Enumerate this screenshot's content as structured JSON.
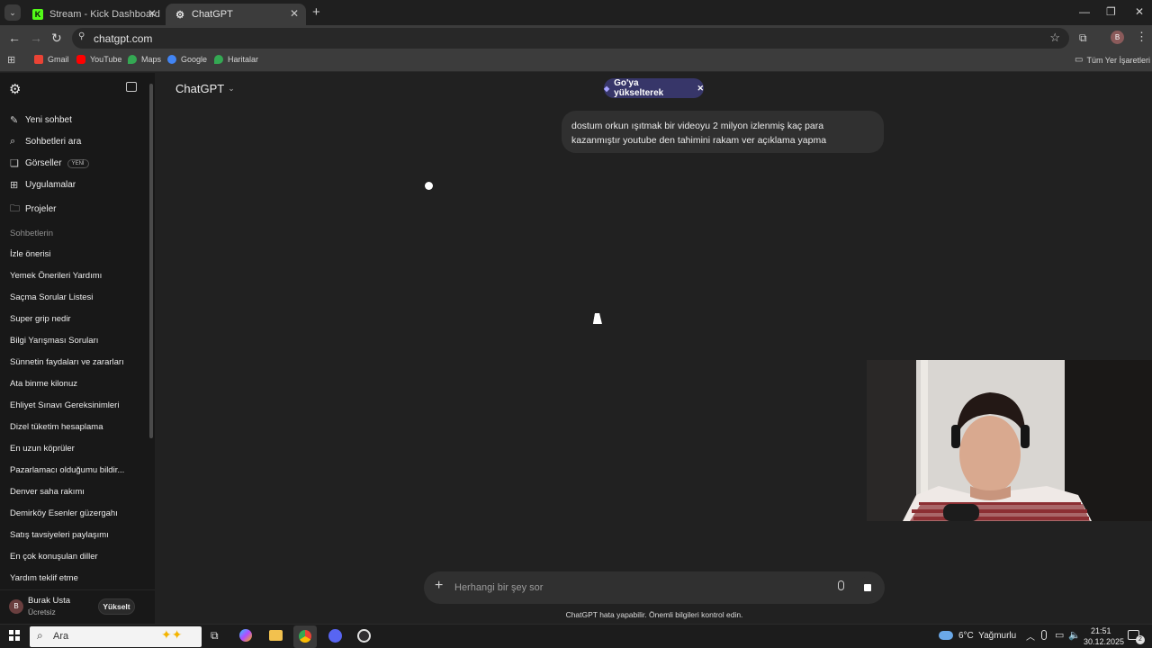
{
  "browser": {
    "tabs": [
      {
        "title": "Stream - Kick Dashboard",
        "favicon": "kick-icon",
        "active": false
      },
      {
        "title": "ChatGPT",
        "favicon": "chatgpt-icon",
        "active": true
      }
    ],
    "url": "chatgpt.com",
    "bookmarks": [
      "Gmail",
      "YouTube",
      "Maps",
      "Google",
      "Haritalar"
    ],
    "all_bookmarks_label": "Tüm Yer İşaretleri",
    "profile_initial": "B"
  },
  "sidebar": {
    "nav": [
      {
        "label": "Yeni sohbet",
        "icon": "new-chat-icon"
      },
      {
        "label": "Sohbetleri ara",
        "icon": "search-icon"
      },
      {
        "label": "Görseller",
        "icon": "images-icon",
        "badge": "YENİ"
      },
      {
        "label": "Uygulamalar",
        "icon": "apps-icon"
      },
      {
        "label": "Projeler",
        "icon": "folder-icon"
      }
    ],
    "section_title": "Sohbetlerin",
    "chats": [
      "İzle önerisi",
      "Yemek Önerileri Yardımı",
      "Saçma Sorular Listesi",
      "Super grip nedir",
      "Bilgi Yarışması Soruları",
      "Sünnetin faydaları ve zararları",
      "Ata binme kilonuz",
      "Ehliyet Sınavı Gereksinimleri",
      "Dizel tüketim hesaplama",
      "En uzun köprüler",
      "Pazarlamacı olduğumu bildir...",
      "Denver saha rakımı",
      "Demirköy Esenler güzergahı",
      "Satış tavsiyeleri paylaşımı",
      "En çok konuşulan diller",
      "Yardım teklif etme"
    ],
    "user": {
      "initial": "B",
      "name": "Burak Usta",
      "plan": "Ücretsiz",
      "upgrade_label": "Yükselt"
    }
  },
  "main": {
    "model_label": "ChatGPT",
    "upgrade_pill": "Go'ya yükselterek",
    "user_message_line1": "dostum orkun ışıtmak bir videoyu 2 milyon izlenmiş kaç para",
    "user_message_line2": "kazanmıştır youtube den tahimini rakam ver açıklama yapma",
    "composer_placeholder": "Herhangi bir şey sor",
    "disclaimer": "ChatGPT hata yapabilir. Önemli bilgileri kontrol edin."
  },
  "taskbar": {
    "search_label": "Ara",
    "weather": "6°C  Yağmurlu",
    "time": "21:51",
    "date": "30.12.2025",
    "notification_count": "2"
  },
  "colors": {
    "sidebar_bg": "#181818",
    "main_bg": "#212121",
    "bubble_bg": "#303030",
    "pill_bg": "#373669",
    "kick_green": "#53fc18"
  }
}
